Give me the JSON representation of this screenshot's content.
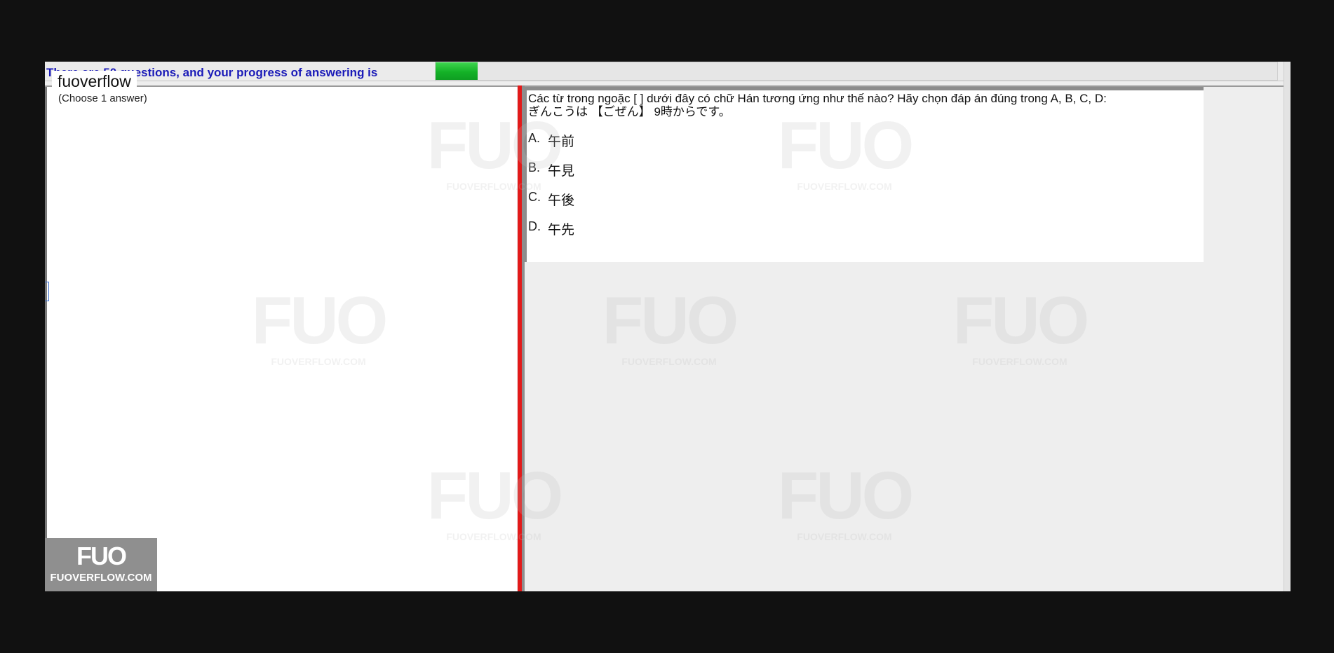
{
  "header": {
    "progress_text": "There are 50 questions, and your progress of answering is",
    "progress_value": 0.05
  },
  "left_pane": {
    "choose_hint": "(Choose 1 answer)",
    "brand_tab": "fuoverflow"
  },
  "question": {
    "line1": "Các từ trong ngoặc [    ] dưới đây có chữ Hán tương ứng như thế nào? Hãy chọn đáp án đúng trong A, B, C, D:",
    "line2": "ぎんこうは 【ごぜん】 9時からです。",
    "answers": [
      {
        "letter": "A.",
        "text": "午前"
      },
      {
        "letter": "B.",
        "text": "午見"
      },
      {
        "letter": "C.",
        "text": "午後"
      },
      {
        "letter": "D.",
        "text": "午先"
      }
    ]
  },
  "watermark": {
    "mark": "FUO",
    "site": "FUOVERFLOW.COM"
  },
  "logo_badge": {
    "mark": "FUO",
    "site": "FUOVERFLOW.COM"
  },
  "colors": {
    "progress_fill": "#14b227",
    "divider": "#e21a1a",
    "progress_text": "#1a1ab8"
  }
}
